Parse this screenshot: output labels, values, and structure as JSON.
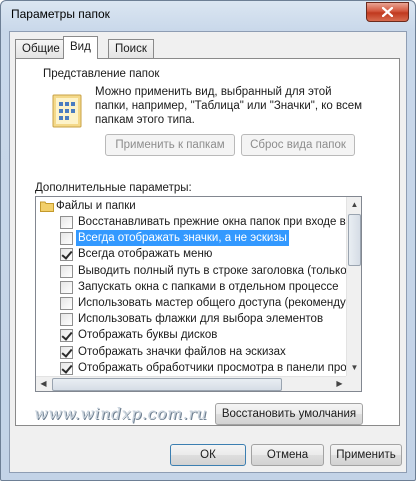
{
  "window": {
    "title": "Параметры папок"
  },
  "tabs": [
    {
      "label": "Общие"
    },
    {
      "label": "Вид"
    },
    {
      "label": "Поиск"
    }
  ],
  "folder_view": {
    "group_title": "Представление папок",
    "description": "Можно применить вид, выбранный для этой папки, например, \"Таблица\" или \"Значки\", ко всем папкам этого типа.",
    "apply_button": "Применить к папкам",
    "reset_button": "Сброс вида папок"
  },
  "advanced": {
    "label": "Дополнительные параметры:",
    "root_label": "Файлы и папки",
    "items": [
      {
        "label": "Восстанавливать прежние окна папок при входе в си",
        "checked": false
      },
      {
        "label": "Всегда отображать значки, а не эскизы",
        "checked": false,
        "selected": true
      },
      {
        "label": "Всегда отображать меню",
        "checked": true
      },
      {
        "label": "Выводить полный путь в строке заголовка (только д",
        "checked": false
      },
      {
        "label": "Запускать окна с папками в отдельном процессе",
        "checked": false
      },
      {
        "label": "Использовать мастер общего доступа (рекомендует",
        "checked": false
      },
      {
        "label": "Использовать флажки для выбора элементов",
        "checked": false
      },
      {
        "label": "Отображать буквы дисков",
        "checked": true
      },
      {
        "label": "Отображать значки файлов на эскизах",
        "checked": true
      },
      {
        "label": "Отображать обработчики просмотра в панели просм",
        "checked": true
      }
    ]
  },
  "restore_defaults_button": "Восстановить умолчания",
  "footer": {
    "ok": "ОК",
    "cancel": "Отмена",
    "apply": "Применить"
  },
  "watermark": "www.windxp.com.ru",
  "colors": {
    "selection": "#3399ff",
    "close_button": "#c0391f",
    "frame": "#c3d3e7"
  }
}
